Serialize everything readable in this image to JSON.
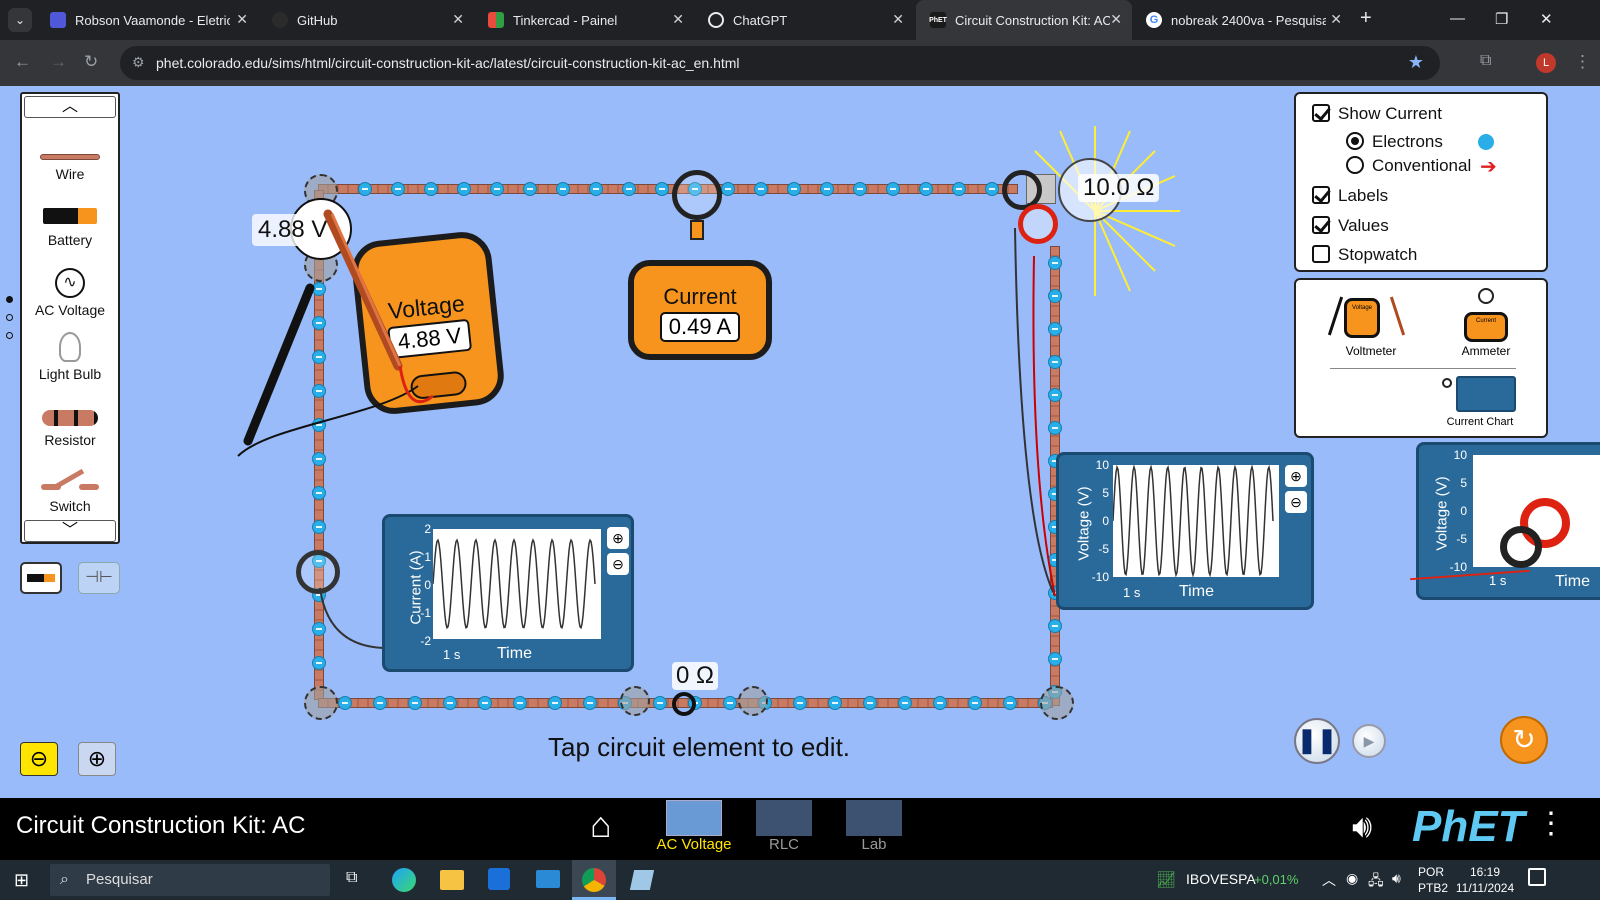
{
  "browser": {
    "tabs": [
      {
        "title": "Robson Vaamonde - Eletricid",
        "color": "#4f58d8"
      },
      {
        "title": "GitHub",
        "color": "#2b2b2b"
      },
      {
        "title": "Tinkercad - Painel",
        "color": "#e94b3c"
      },
      {
        "title": "ChatGPT",
        "color": "#202124"
      },
      {
        "title": "Circuit Construction Kit: AC",
        "color": "#1a1a1a",
        "active": true
      },
      {
        "title": "nobreak 2400va - Pesquisa G",
        "color": "#ffffff"
      }
    ],
    "url": "phet.colorado.edu/sims/html/circuit-construction-kit-ac/latest/circuit-construction-kit-ac_en.html",
    "profile_letter": "L"
  },
  "toolbox": {
    "items": [
      "Wire",
      "Battery",
      "AC Voltage",
      "Light Bulb",
      "Resistor",
      "Switch"
    ]
  },
  "circuit": {
    "voltage_label": "4.88 V",
    "resistance_label": "10.0 Ω",
    "switch_label": "0 Ω"
  },
  "voltmeter": {
    "title": "Voltage",
    "reading": "4.88 V"
  },
  "ammeter": {
    "title": "Current",
    "reading": "0.49 A"
  },
  "current_chart": {
    "ylabel": "Current (A)",
    "xlabel": "Time",
    "scale": "1 s",
    "ticks": [
      "2",
      "1",
      "0",
      "-1",
      "-2"
    ]
  },
  "voltage_chart": {
    "ylabel": "Voltage (V)",
    "xlabel": "Time",
    "scale": "1 s",
    "ticks": [
      "10",
      "5",
      "0",
      "-5",
      "-10"
    ]
  },
  "voltage_chart_2": {
    "ylabel": "Voltage (V)",
    "xlabel": "Time",
    "scale": "1 s",
    "ticks": [
      "10",
      "5",
      "0",
      "-5",
      "-10"
    ]
  },
  "options": {
    "show_current": "Show Current",
    "electrons": "Electrons",
    "conventional": "Conventional",
    "labels": "Labels",
    "values": "Values",
    "stopwatch": "Stopwatch"
  },
  "sensors": {
    "voltmeter": "Voltmeter",
    "ammeter": "Ammeter",
    "current_chart": "Current Chart",
    "icon_voltage": "Voltage",
    "icon_current": "Current"
  },
  "hint": "Tap circuit element to edit.",
  "nav": {
    "title": "Circuit Construction Kit: AC",
    "screens": [
      "AC Voltage",
      "RLC",
      "Lab"
    ],
    "brand": "PhET"
  },
  "taskbar": {
    "search": "Pesquisar",
    "stock_name": "IBOVESPA",
    "stock_change": "+0,01%",
    "lang1": "POR",
    "lang2": "PTB2",
    "time": "16:19",
    "date": "11/11/2024"
  },
  "colors": {
    "accent_selected": "#ffe500",
    "electron": "#2aaee8",
    "meter": "#f7941d"
  }
}
